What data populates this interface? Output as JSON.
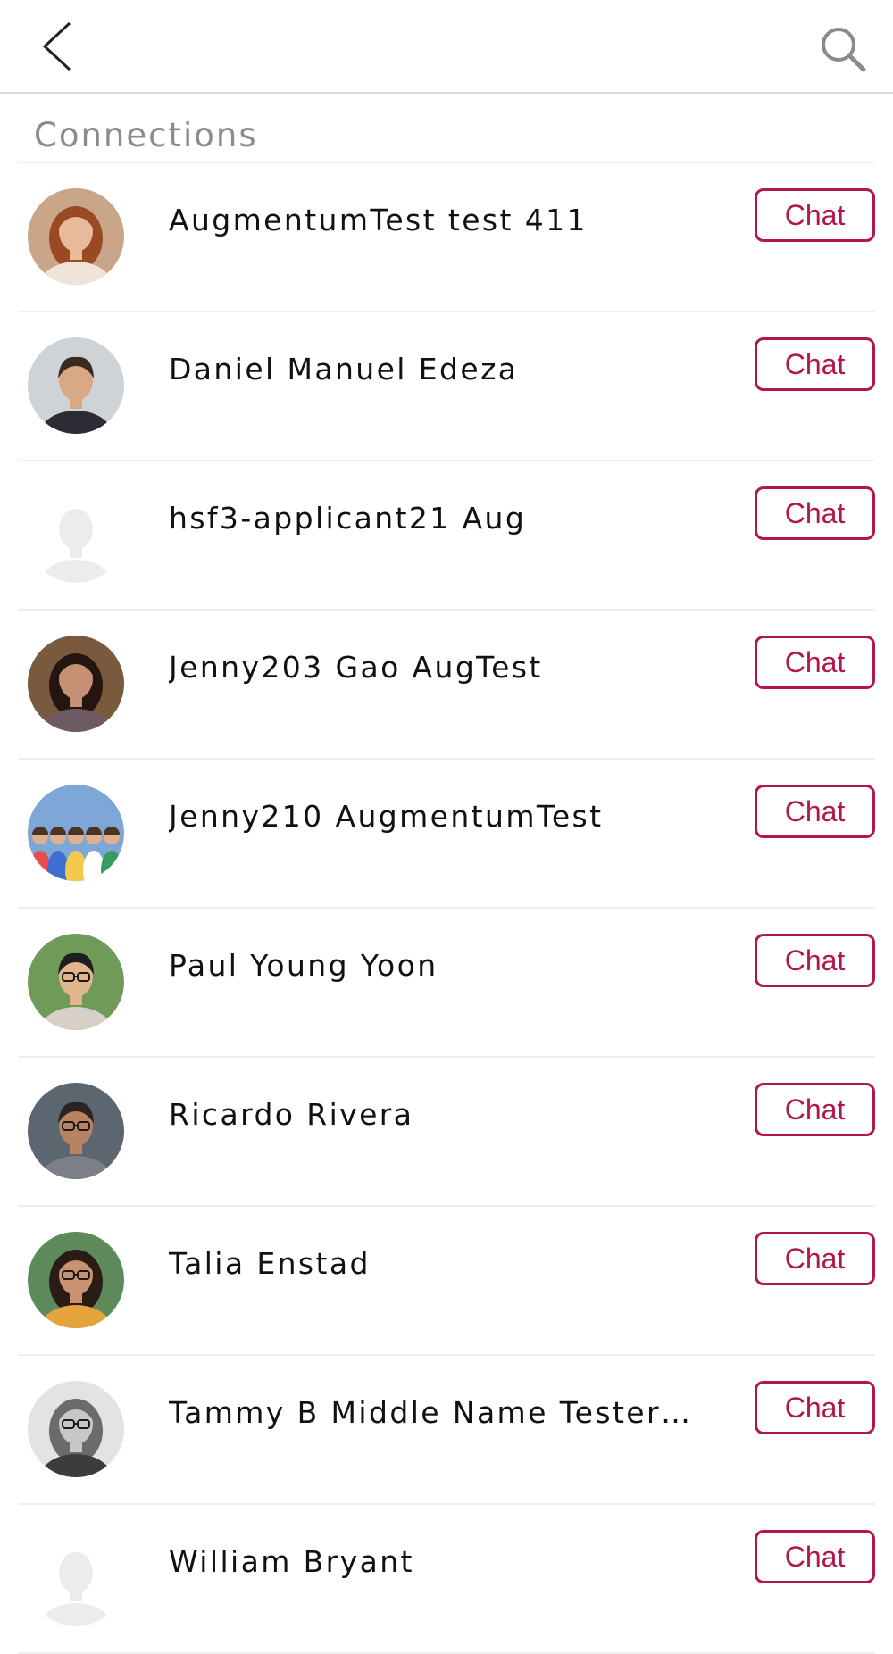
{
  "header": {
    "back_icon": "chevron-left-icon",
    "search_icon": "search-icon"
  },
  "section": {
    "title": "Connections"
  },
  "connections": [
    {
      "name": "AugmentumTest test 411",
      "action": "Chat",
      "avatar": "photo-woman-red-hair"
    },
    {
      "name": "Daniel Manuel Edeza",
      "action": "Chat",
      "avatar": "photo-man-suit"
    },
    {
      "name": "hsf3-applicant21 Aug",
      "action": "Chat",
      "avatar": "default-silhouette"
    },
    {
      "name": "Jenny203 Gao AugTest",
      "action": "Chat",
      "avatar": "photo-woman-dark-hair"
    },
    {
      "name": "Jenny210 AugmentumTest",
      "action": "Chat",
      "avatar": "photo-group-people"
    },
    {
      "name": "Paul Young Yoon",
      "action": "Chat",
      "avatar": "photo-man-glasses"
    },
    {
      "name": "Ricardo Rivera",
      "action": "Chat",
      "avatar": "photo-man-office"
    },
    {
      "name": "Talia Enstad",
      "action": "Chat",
      "avatar": "photo-woman-glasses"
    },
    {
      "name": "Tammy B Middle Name Tester Sch...",
      "action": "Chat",
      "avatar": "photo-woman-grayscale"
    },
    {
      "name": "William Bryant",
      "action": "Chat",
      "avatar": "default-silhouette"
    }
  ],
  "colors": {
    "accent": "#b1174a",
    "divider": "#eeeeee",
    "section_title": "#8c8c8c"
  }
}
